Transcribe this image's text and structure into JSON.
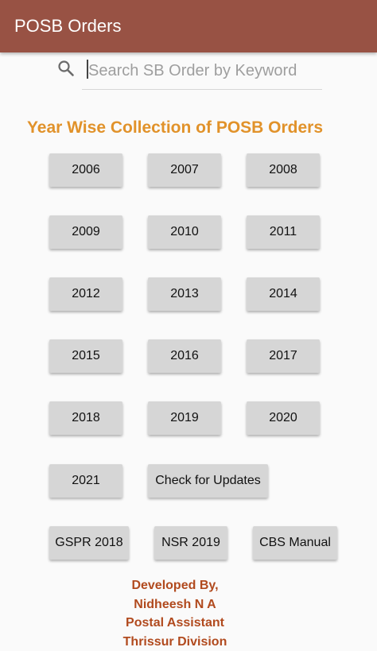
{
  "appbar": {
    "title": "POSB Orders",
    "color": "#985244"
  },
  "search": {
    "icon": "search-icon",
    "placeholder": "Search SB Order by Keyword",
    "value": ""
  },
  "section": {
    "title": "Year Wise Collection of POSB Orders",
    "color": "#e1922a"
  },
  "year_buttons": [
    "2006",
    "2007",
    "2008",
    "2009",
    "2010",
    "2011",
    "2012",
    "2013",
    "2014",
    "2015",
    "2016",
    "2017",
    "2018",
    "2019",
    "2020",
    "2021"
  ],
  "actions": {
    "check_updates": "Check for Updates",
    "gspr": "GSPR 2018",
    "nsr": "NSR 2019",
    "cbs": "CBS Manual"
  },
  "footer": {
    "lines": [
      "Developed By,",
      "Nidheesh N A",
      "Postal Assistant",
      "Thrissur Division"
    ],
    "color": "#b14a1e"
  }
}
